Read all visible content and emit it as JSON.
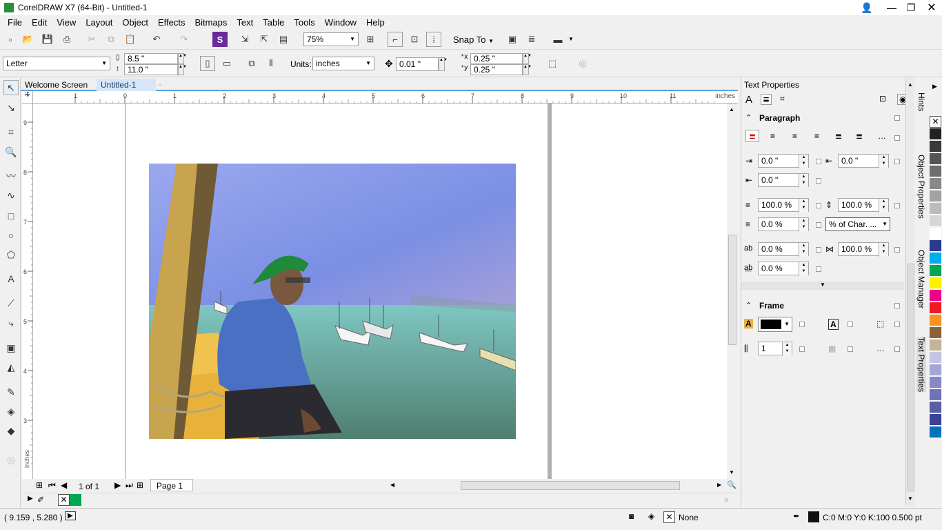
{
  "window": {
    "title": "CorelDRAW X7 (64-Bit) - Untitled-1"
  },
  "menu": [
    "File",
    "Edit",
    "View",
    "Layout",
    "Object",
    "Effects",
    "Bitmaps",
    "Text",
    "Table",
    "Tools",
    "Window",
    "Help"
  ],
  "toolbar": {
    "zoom": "75%",
    "snap_to": "Snap To"
  },
  "property_bar": {
    "page_size": "Letter",
    "width": "8.5 \"",
    "height": "11.0 \"",
    "units_label": "Units:",
    "units": "inches",
    "nudge": "0.01 \"",
    "dup_x": "0.25 \"",
    "dup_y": "0.25 \""
  },
  "doc_tabs": [
    "Welcome Screen",
    "Untitled-1"
  ],
  "ruler": {
    "h_ticks": [
      "1",
      "0",
      "1",
      "2",
      "3",
      "4",
      "5",
      "6",
      "7",
      "8",
      "9",
      "10",
      "11"
    ],
    "h_unit": "inches",
    "v_ticks": [
      "9",
      "8",
      "7",
      "6",
      "5",
      "4",
      "3"
    ],
    "v_unit": "inches"
  },
  "page_nav": {
    "counter": "1 of 1",
    "page_tab": "Page 1"
  },
  "status": {
    "coords": "( 9.159 , 5.280 )",
    "fill": "None",
    "outline": "C:0 M:0 Y:0 K:100  0.500 pt"
  },
  "docker": {
    "title": "Text Properties",
    "paragraph": {
      "heading": "Paragraph",
      "left_indent": "0.0 \"",
      "first_line": "0.0 \"",
      "right_indent": "0.0 \"",
      "line_spacing": "100.0 %",
      "char_spacing": "100.0 %",
      "before_para": "0.0 %",
      "spacing_unit": "% of Char. ...",
      "word_spacing": "0.0 %",
      "lang_spacing": "100.0 %",
      "lang_spacing2": "0.0 %"
    },
    "frame": {
      "heading": "Frame",
      "columns": "1"
    }
  },
  "side_tabs": [
    "Hints",
    "Object Properties",
    "Object Manager",
    "Text Properties"
  ],
  "palette": [
    "#222222",
    "#3a3a3a",
    "#555555",
    "#6e6e6e",
    "#888888",
    "#a2a2a2",
    "#bcbcbc",
    "#d6d6d6",
    "#ffffff",
    "#2b3990",
    "#00aeef",
    "#00a651",
    "#fff200",
    "#ec008c",
    "#ed1c24",
    "#f7941d",
    "#8c6239",
    "#c2b59b",
    "#c4c4e4",
    "#a6a6d6",
    "#8888c8",
    "#6f73b6",
    "#5a5ea6",
    "#3d4296",
    "#0072bc"
  ]
}
